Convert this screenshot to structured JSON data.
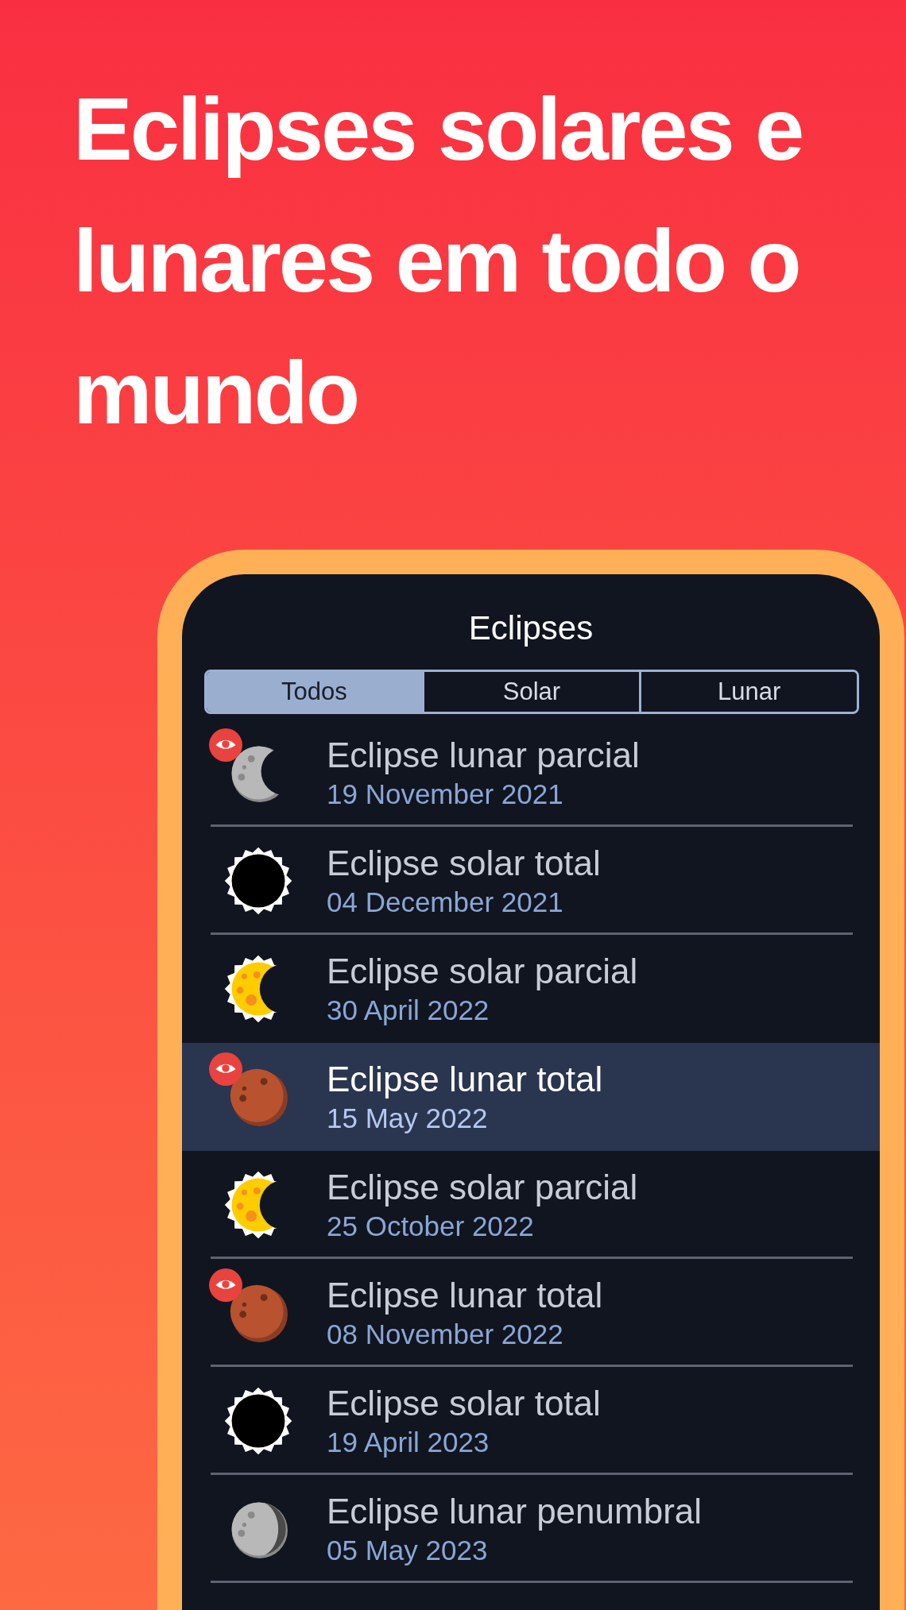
{
  "headline": "Eclipses solares e lunares em todo o mundo",
  "app": {
    "title": "Eclipses",
    "tabs": [
      {
        "label": "Todos",
        "selected": true
      },
      {
        "label": "Solar",
        "selected": false
      },
      {
        "label": "Lunar",
        "selected": false
      }
    ],
    "rows": [
      {
        "kind": "lunar_partial",
        "visible": true,
        "selected": false,
        "title": "Eclipse lunar parcial",
        "date": "19 November 2021"
      },
      {
        "kind": "solar_total",
        "visible": false,
        "selected": false,
        "title": "Eclipse solar total",
        "date": "04 December 2021"
      },
      {
        "kind": "solar_partial",
        "visible": false,
        "selected": false,
        "title": "Eclipse solar parcial",
        "date": "30 April 2022"
      },
      {
        "kind": "lunar_total",
        "visible": true,
        "selected": true,
        "title": "Eclipse lunar total",
        "date": "15 May 2022"
      },
      {
        "kind": "solar_partial",
        "visible": false,
        "selected": false,
        "title": "Eclipse solar parcial",
        "date": "25 October 2022"
      },
      {
        "kind": "lunar_total",
        "visible": true,
        "selected": false,
        "title": "Eclipse lunar total",
        "date": "08 November 2022"
      },
      {
        "kind": "solar_total",
        "visible": false,
        "selected": false,
        "title": "Eclipse solar total",
        "date": "19 April 2023"
      },
      {
        "kind": "lunar_penumbral",
        "visible": false,
        "selected": false,
        "title": "Eclipse lunar penumbral",
        "date": "05 May 2023"
      }
    ]
  }
}
